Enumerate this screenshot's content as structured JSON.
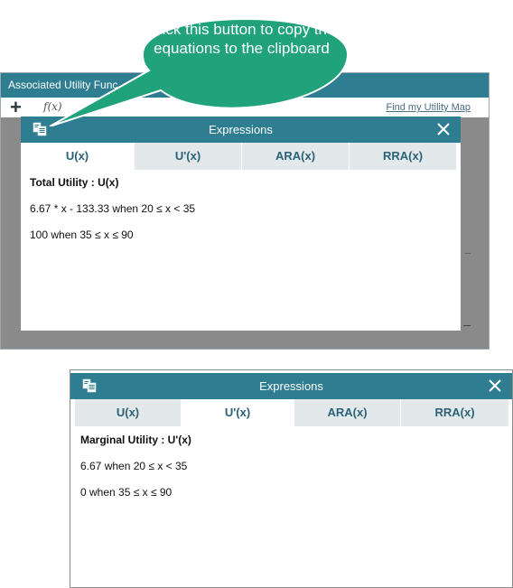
{
  "background_window": {
    "title": "Associated Utility Func",
    "plus_icon": "+",
    "fx_label": "f(x)",
    "link": "Find my Utility Map"
  },
  "callout": {
    "text": "Click this button to copy the equations to the clipboard",
    "color": "#20a37a"
  },
  "colors": {
    "header": "#2e7d91",
    "tab_inactive": "#e3e8ea",
    "tab_text": "#2b6278"
  },
  "icons": {
    "copy": "copy-clipboard-icon",
    "close": "close-icon"
  },
  "dialog_top": {
    "title": "Expressions",
    "tabs": [
      "U(x)",
      "U'(x)",
      "ARA(x)",
      "RRA(x)"
    ],
    "active_tab": "U(x)",
    "label": "Total Utility : U(x)",
    "equations": [
      "6.67 * x - 133.33 when 20 ≤ x < 35",
      "100 when 35 ≤ x ≤ 90"
    ]
  },
  "dialog_bottom": {
    "title": "Expressions",
    "tabs": [
      "U(x)",
      "U'(x)",
      "ARA(x)",
      "RRA(x)"
    ],
    "active_tab": "U'(x)",
    "label": "Marginal Utility : U'(x)",
    "equations": [
      "6.67 when 20 ≤ x < 35",
      "0 when 35 ≤ x ≤ 90"
    ]
  }
}
